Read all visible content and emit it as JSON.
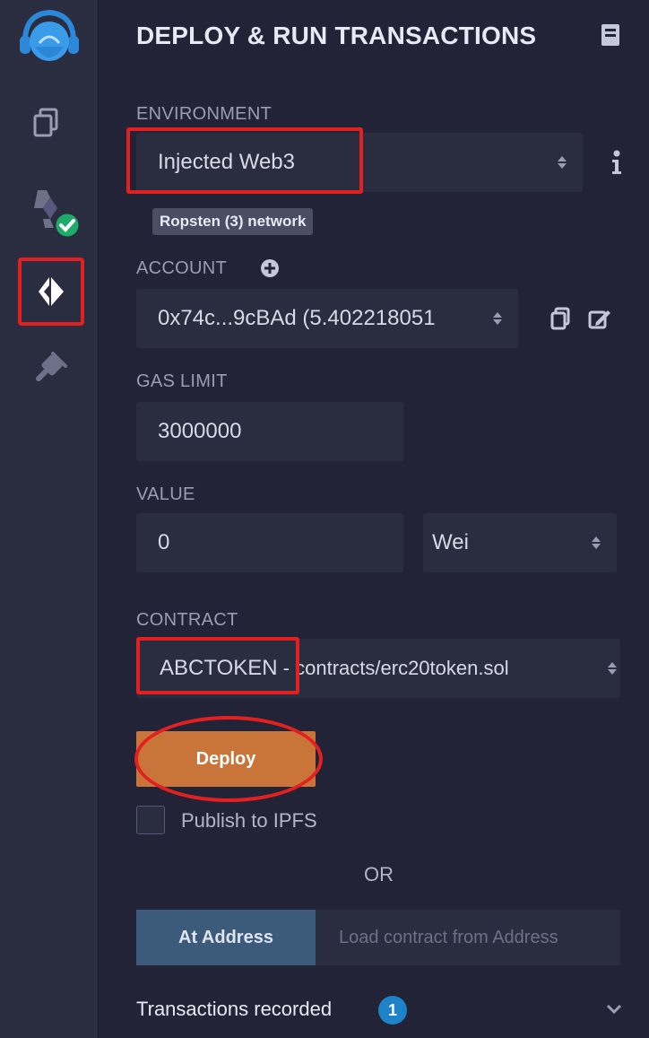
{
  "sidebar": {
    "icons": [
      "remix-logo-icon",
      "file-explorer-icon",
      "solidity-compiler-icon",
      "deploy-run-icon",
      "plugin-manager-icon"
    ]
  },
  "panel": {
    "title": "DEPLOY & RUN TRANSACTIONS",
    "environment": {
      "label": "ENVIRONMENT",
      "value": "Injected Web3",
      "network": "Ropsten (3) network"
    },
    "account": {
      "label": "ACCOUNT",
      "value": "0x74c...9cBAd (5.402218051"
    },
    "gas_limit": {
      "label": "GAS LIMIT",
      "value": "3000000"
    },
    "value": {
      "label": "VALUE",
      "amount": "0",
      "unit": "Wei"
    },
    "contract": {
      "label": "CONTRACT",
      "name": "ABCTOKEN",
      "path": " - contracts/erc20token.sol"
    },
    "deploy_label": "Deploy",
    "publish_label": "Publish to IPFS",
    "or_label": "OR",
    "at_address_label": "At Address",
    "address_placeholder": "Load contract from Address",
    "transactions": {
      "label": "Transactions recorded",
      "count": "1"
    }
  },
  "colors": {
    "accent_deploy": "#c97539",
    "at_address": "#3c5b7a",
    "badge": "#1d82c8",
    "highlight": "#e32020",
    "success": "#1dab6a"
  }
}
